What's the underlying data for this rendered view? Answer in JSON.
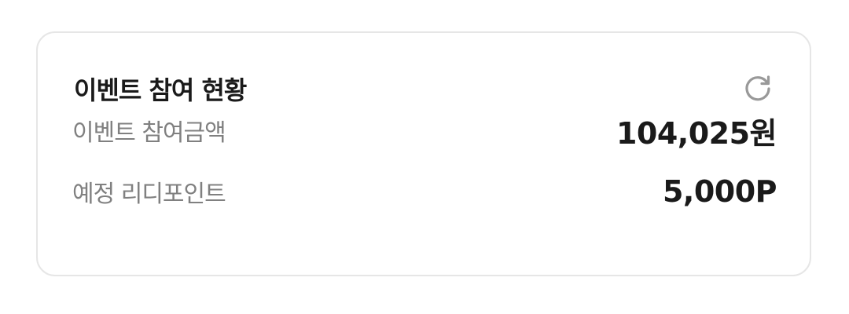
{
  "card": {
    "title": "이벤트 참여 현황",
    "refresh_icon": "refresh-icon",
    "rows": [
      {
        "label": "이벤트 참여금액",
        "value": "104,025원"
      },
      {
        "label": "예정 리디포인트",
        "value": "5,000P"
      }
    ]
  },
  "colors": {
    "title": "#1a1a1a",
    "label": "#808080",
    "value": "#1a1a1a",
    "border": "#e6e6e6",
    "icon": "#999999"
  }
}
